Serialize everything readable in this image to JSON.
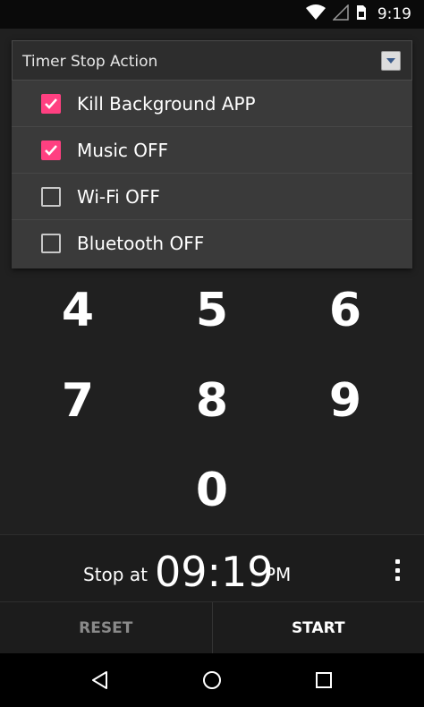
{
  "status_bar": {
    "time": "9:19",
    "icons": [
      "wifi-icon",
      "signal-icon",
      "sim-card-icon"
    ]
  },
  "dropdown": {
    "title": "Timer Stop Action",
    "options": [
      {
        "label": "Kill Background APP",
        "checked": true
      },
      {
        "label": "Music OFF",
        "checked": true
      },
      {
        "label": "Wi-Fi OFF",
        "checked": false
      },
      {
        "label": "Bluetooth OFF",
        "checked": false
      }
    ]
  },
  "keypad": {
    "keys": [
      "4",
      "5",
      "6",
      "7",
      "8",
      "9",
      "0"
    ]
  },
  "stop_at": {
    "label": "Stop at",
    "time": "09:19",
    "ampm": "PM"
  },
  "buttons": {
    "reset": "RESET",
    "start": "START"
  },
  "nav": [
    "back-icon",
    "home-icon",
    "recents-icon"
  ],
  "colors": {
    "accent": "#ff4081",
    "background": "#202020"
  }
}
